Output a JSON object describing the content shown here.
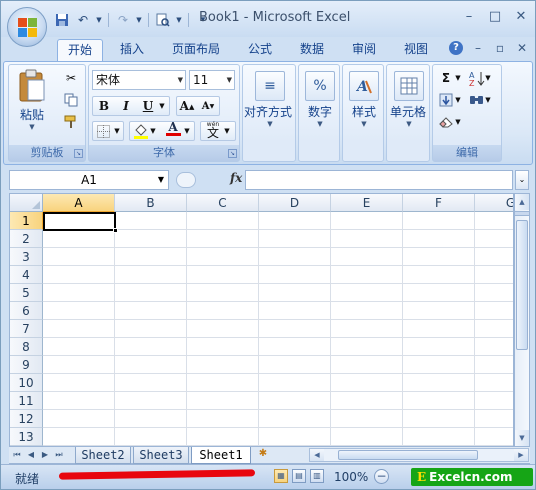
{
  "window": {
    "title": "Book1 - Microsoft Excel",
    "controls": [
      "–",
      "□",
      "✕"
    ]
  },
  "quick_access": {
    "icons": [
      "save-icon",
      "undo-icon",
      "redo-icon",
      "print-preview-icon",
      "customize-icon"
    ]
  },
  "tabs": [
    {
      "label": "开始",
      "active": true
    },
    {
      "label": "插入",
      "active": false
    },
    {
      "label": "页面布局",
      "active": false
    },
    {
      "label": "公式",
      "active": false
    },
    {
      "label": "数据",
      "active": false
    },
    {
      "label": "审阅",
      "active": false
    },
    {
      "label": "视图",
      "active": false
    }
  ],
  "ribbon": {
    "clipboard": {
      "paste_label": "粘贴",
      "group_label": "剪贴板"
    },
    "font": {
      "font_name": "宋体",
      "font_size": "11",
      "bold": "B",
      "italic": "I",
      "underline": "U",
      "grow": "A",
      "shrink": "A",
      "font_color_letter": "A",
      "phonetic": "文",
      "phonetic_top": "wén",
      "group_label": "字体"
    },
    "alignment_label": "对齐方式",
    "number_label": "数字",
    "number_icon": "%",
    "styles_label": "样式",
    "cells_label": "单元格",
    "editing": {
      "group_label": "编辑",
      "sum": "Σ"
    }
  },
  "formula_bar": {
    "name_box": "A1",
    "fx": "fx",
    "value": ""
  },
  "grid": {
    "columns": [
      "A",
      "B",
      "C",
      "D",
      "E",
      "F",
      "G"
    ],
    "rows": [
      "1",
      "2",
      "3",
      "4",
      "5",
      "6",
      "7",
      "8",
      "9",
      "10",
      "11",
      "12",
      "13"
    ],
    "selected_column": "A",
    "selected_row": "1"
  },
  "sheets": [
    {
      "label": "Sheet2",
      "active": false
    },
    {
      "label": "Sheet3",
      "active": false
    },
    {
      "label": "Sheet1",
      "active": true
    }
  ],
  "status_bar": {
    "state": "就绪",
    "zoom": "100%",
    "zoom_minus": "−"
  },
  "watermark": {
    "letter": "E",
    "text": "Excelcn.com"
  },
  "colors": {
    "active_header": "#f8d37e",
    "annotation_line": "#e8060e",
    "watermark_bg": "#16a516"
  }
}
